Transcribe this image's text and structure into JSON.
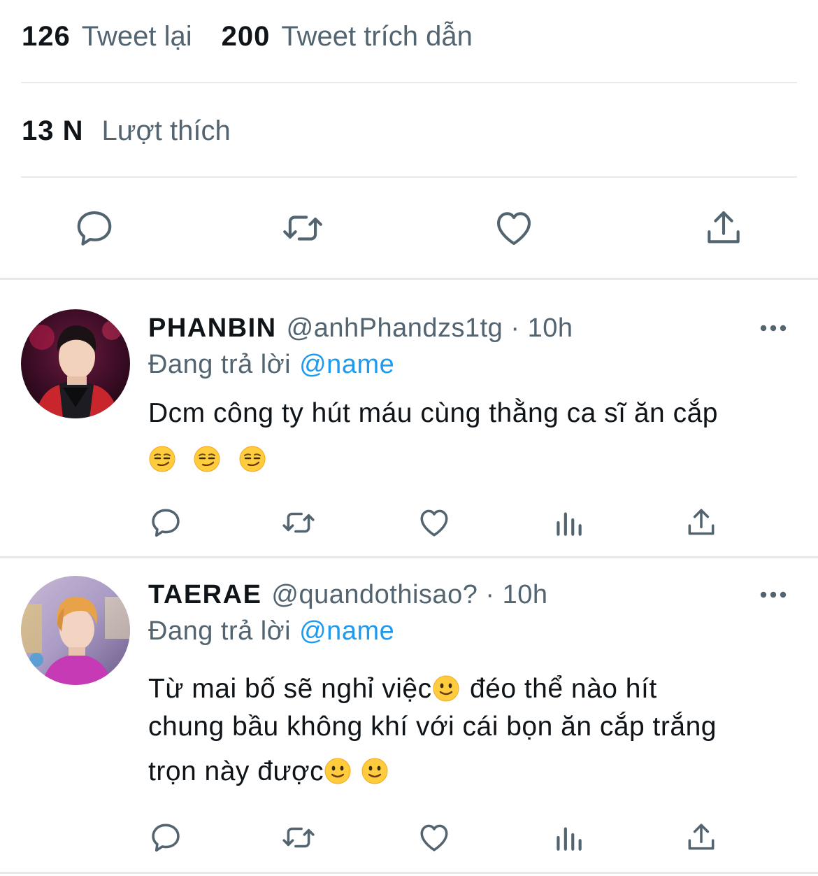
{
  "stats": {
    "retweets_count": "126",
    "retweets_label": "Tweet lại",
    "quotes_count": "200",
    "quotes_label": "Tweet trích dẫn",
    "likes_count": "13 N",
    "likes_label": "Lượt thích"
  },
  "icons": {
    "reply": "reply-icon",
    "retweet": "retweet-icon",
    "like": "heart-icon",
    "share": "share-icon",
    "analytics": "analytics-icon",
    "more": "more-icon",
    "emoji_smirk": "smirk-emoji",
    "emoji_smile": "smile-emoji"
  },
  "colors": {
    "text_primary": "#0f1419",
    "text_secondary": "#536471",
    "link": "#1d9bf0",
    "divider": "#e8ebee"
  },
  "replies": [
    {
      "name": "PHANBIN",
      "handle": "@anhPhandzs1tg · 10h",
      "replying_label": "Đang trả lời",
      "mention": "@name",
      "text_line1": "Dcm công ty hút máu cùng thằng ca sĩ ăn cắp",
      "emojis": [
        "😏",
        "😏",
        "😏"
      ]
    },
    {
      "name": "TAERAE",
      "handle": "@quandothisao? · 10h",
      "replying_label": "Đang trả lời",
      "mention": "@name",
      "text_line1a": "Từ mai bố sẽ nghỉ việc",
      "text_line1b": " đéo thể nào hít",
      "text_line2": "chung bầu không khí với cái bọn ăn cắp trắng",
      "text_line3": "trọn này được",
      "emojis": [
        "🙂",
        "🙂",
        "🙂"
      ]
    }
  ]
}
